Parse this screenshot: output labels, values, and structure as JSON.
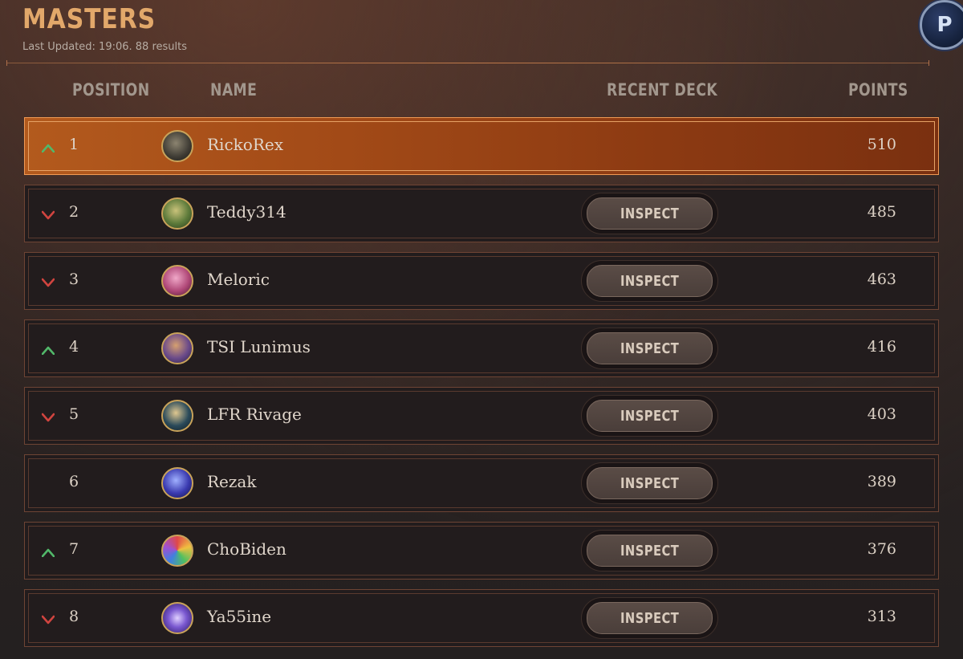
{
  "header": {
    "title": "MASTERS",
    "last_updated": "Last Updated: 19:06. 88 results",
    "profile_icon": "P"
  },
  "columns": {
    "position": "POSITION",
    "name": "NAME",
    "recent_deck": "RECENT DECK",
    "points": "POINTS"
  },
  "colors": {
    "up": "#52b86a",
    "down": "#d0443f",
    "accent": "#e2a86a",
    "highlight_row": "#a24a17"
  },
  "rows": [
    {
      "position": "1",
      "name": "RickoRex",
      "points": "510",
      "trend": "up",
      "avatar_icon": "rickorex-avatar-icon",
      "inspect": ""
    },
    {
      "position": "2",
      "name": "Teddy314",
      "points": "485",
      "trend": "down",
      "avatar_icon": "teddy314-avatar-icon",
      "inspect": "INSPECT"
    },
    {
      "position": "3",
      "name": "Meloric",
      "points": "463",
      "trend": "down",
      "avatar_icon": "meloric-avatar-icon",
      "inspect": "INSPECT"
    },
    {
      "position": "4",
      "name": "TSI Lunimus",
      "points": "416",
      "trend": "up",
      "avatar_icon": "tsi-lunimus-avatar-icon",
      "inspect": "INSPECT"
    },
    {
      "position": "5",
      "name": "LFR Rivage",
      "points": "403",
      "trend": "down",
      "avatar_icon": "lfr-rivage-avatar-icon",
      "inspect": "INSPECT"
    },
    {
      "position": "6",
      "name": "Rezak",
      "points": "389",
      "trend": "none",
      "avatar_icon": "rezak-avatar-icon",
      "inspect": "INSPECT"
    },
    {
      "position": "7",
      "name": "ChoBiden",
      "points": "376",
      "trend": "up",
      "avatar_icon": "chobiden-avatar-icon",
      "inspect": "INSPECT"
    },
    {
      "position": "8",
      "name": "Ya55ine",
      "points": "313",
      "trend": "down",
      "avatar_icon": "ya55ine-avatar-icon",
      "inspect": "INSPECT"
    }
  ]
}
